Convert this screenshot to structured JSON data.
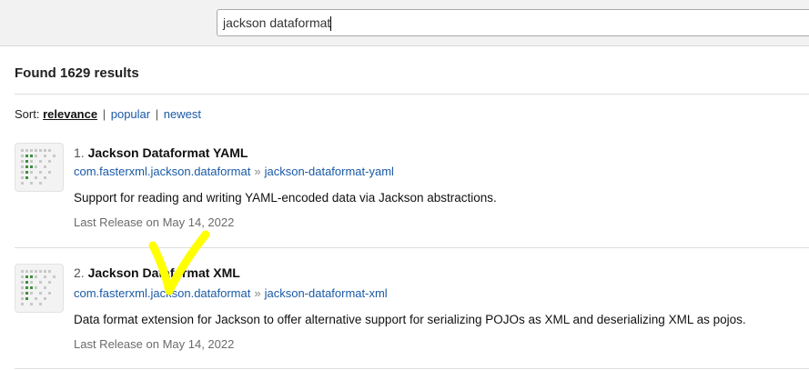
{
  "search": {
    "query": "jackson dataformat"
  },
  "results_header": {
    "found_text": "Found 1629 results"
  },
  "sort": {
    "label": "Sort:",
    "options": [
      "relevance",
      "popular",
      "newest"
    ],
    "separator": "|"
  },
  "results": [
    {
      "number": "1.",
      "name": "Jackson Dataformat YAML",
      "group": "com.fasterxml.jackson.dataformat",
      "arrow": "»",
      "artifact": "jackson-dataformat-yaml",
      "description": "Support for reading and writing YAML-encoded data via Jackson abstractions.",
      "release": "Last Release on May 14, 2022",
      "logo_icon": "fasterxml-logo-icon"
    },
    {
      "number": "2.",
      "name": "Jackson Dataformat XML",
      "group": "com.fasterxml.jackson.dataformat",
      "arrow": "»",
      "artifact": "jackson-dataformat-xml",
      "description": "Data format extension for Jackson to offer alternative support for serializing POJOs as XML and deserializing XML as pojos.",
      "release": "Last Release on May 14, 2022",
      "logo_icon": "fasterxml-logo-icon"
    }
  ],
  "annotation": {
    "icon": "yellow-checkmark-icon",
    "color": "#ffff00"
  },
  "colors": {
    "link": "#1a5aa6",
    "muted": "#6b6b6b",
    "topbar": "#f2f2f2"
  }
}
